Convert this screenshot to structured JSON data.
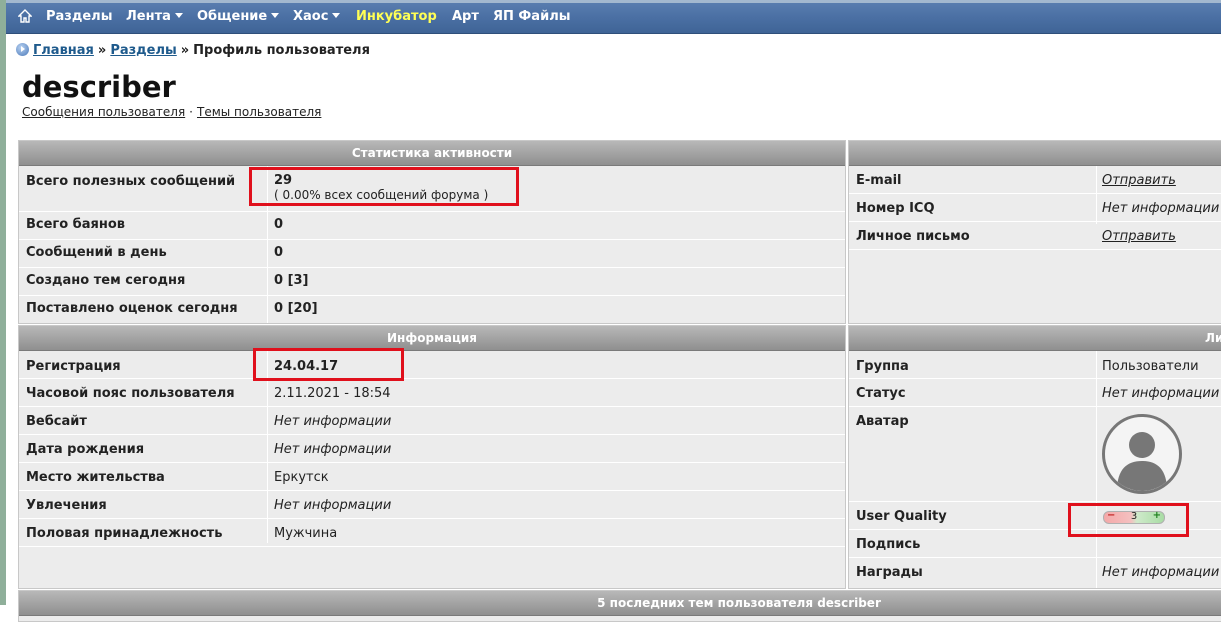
{
  "nav": {
    "items": [
      {
        "label": "Разделы",
        "dropdown": false,
        "highlight": false
      },
      {
        "label": "Лента",
        "dropdown": true,
        "highlight": false
      },
      {
        "label": "Общение",
        "dropdown": true,
        "highlight": false
      },
      {
        "label": "Хаос",
        "dropdown": true,
        "highlight": false
      },
      {
        "label": "Инкубатор",
        "dropdown": false,
        "highlight": true
      },
      {
        "label": "Арт",
        "dropdown": false,
        "highlight": false
      },
      {
        "label": "ЯП Файлы",
        "dropdown": false,
        "highlight": false
      }
    ]
  },
  "breadcrumb": {
    "home": "Главная",
    "sections": "Разделы",
    "sep": "»",
    "current": "Профиль пользователя"
  },
  "profile": {
    "username": "describer",
    "links": {
      "posts": "Сообщения пользователя",
      "dot": "·",
      "topics": "Темы пользователя"
    }
  },
  "stats": {
    "title": "Статистика активности",
    "useful_label": "Всего полезных сообщений",
    "useful_value": "29",
    "useful_share": "( 0.00% всех сообщений форума )",
    "rows": [
      {
        "label": "Всего баянов",
        "value": "0"
      },
      {
        "label": "Сообщений в день",
        "value": "0"
      },
      {
        "label": "Создано тем сегодня",
        "value": "0 [3]"
      },
      {
        "label": "Поставлено оценок сегодня",
        "value": "0 [20]"
      }
    ]
  },
  "contacts": {
    "title": "",
    "rows": [
      {
        "label": "E-mail",
        "value": "Отправить"
      },
      {
        "label": "Номер ICQ",
        "value": "Нет информации"
      },
      {
        "label": "Личное письмо",
        "value": "Отправить"
      }
    ]
  },
  "info": {
    "title": "Информация",
    "rows": [
      {
        "label": "Регистрация",
        "value": "24.04.17"
      },
      {
        "label": "Часовой пояс пользователя",
        "value": "2.11.2021 - 18:54"
      },
      {
        "label": "Вебсайт",
        "value": "Нет информации"
      },
      {
        "label": "Дата рождения",
        "value": "Нет информации"
      },
      {
        "label": "Место жительства",
        "value": "Еркутск"
      },
      {
        "label": "Увлечения",
        "value": "Нет информации"
      },
      {
        "label": "Половая принадлежность",
        "value": "Мужчина"
      }
    ]
  },
  "personal": {
    "title": "Ли",
    "group_label": "Группа",
    "group_value": "Пользователи",
    "status_label": "Статус",
    "status_value": "Нет информации",
    "avatar_label": "Аватар",
    "quality_label": "User Quality",
    "quality": {
      "minus": "−",
      "value": "3",
      "plus": "+"
    },
    "signature_label": "Подпись",
    "awards_label": "Награды",
    "awards_value": "Нет информации"
  },
  "bottom": {
    "title": "5 последних тем пользователя describer"
  },
  "colors": {
    "nav": "#4a6fa3",
    "highlight": "#ffff55",
    "panel": "#ececec",
    "annotation": "#e0101c",
    "link": "#1e5a8c"
  }
}
